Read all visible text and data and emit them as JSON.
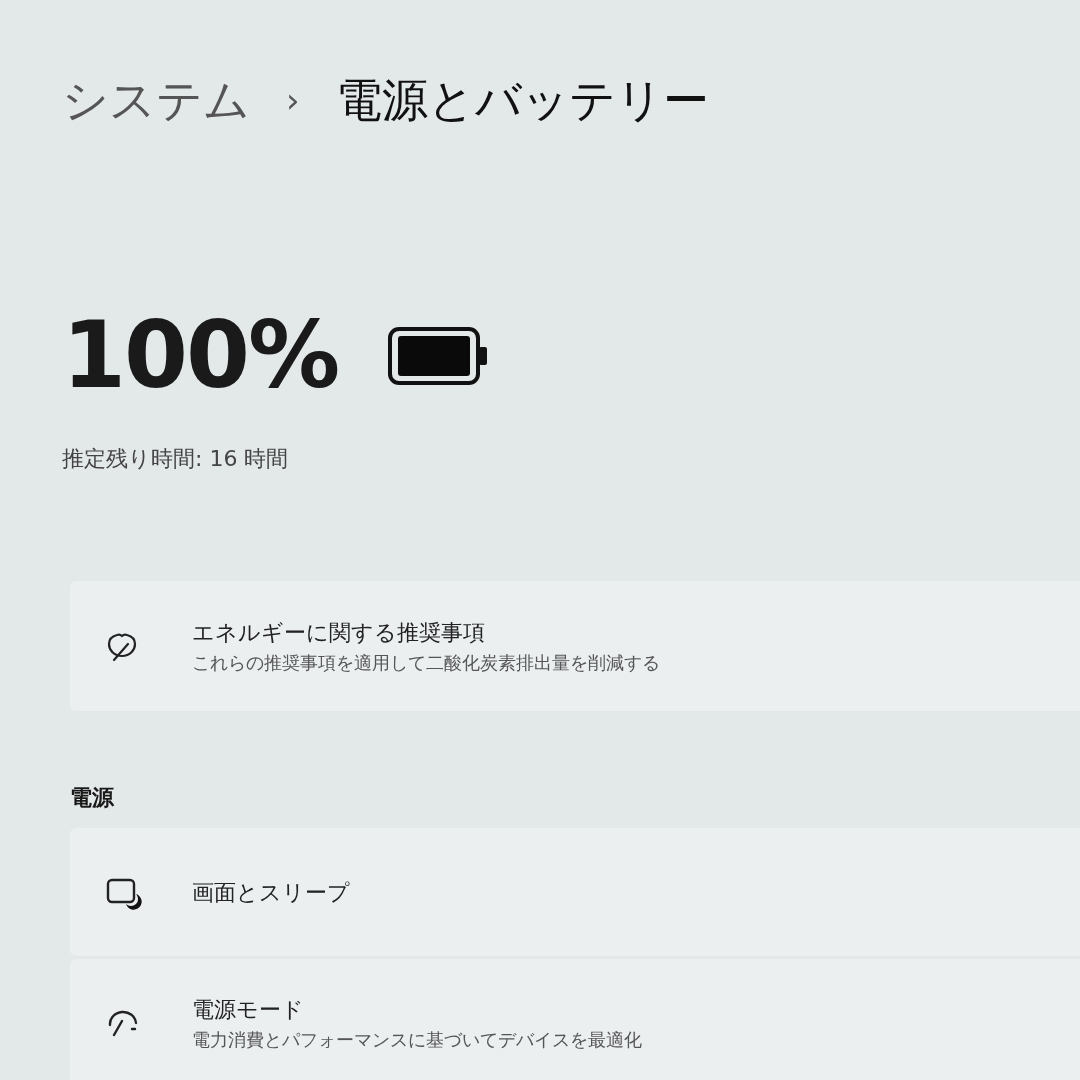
{
  "breadcrumb": {
    "parent": "システム",
    "separator": "›",
    "current": "電源とバッテリー"
  },
  "battery": {
    "percent": "100%",
    "estimate": "推定残り時間: 16 時間"
  },
  "recommendation": {
    "title": "エネルギーに関する推奨事項",
    "subtitle": "これらの推奨事項を適用して二酸化炭素排出量を削減する"
  },
  "sections": [
    {
      "title": "電源",
      "items": [
        {
          "title": "画面とスリープ"
        },
        {
          "title": "電源モード",
          "subtitle": "電力消費とパフォーマンスに基づいてデバイスを最適化"
        }
      ]
    }
  ]
}
